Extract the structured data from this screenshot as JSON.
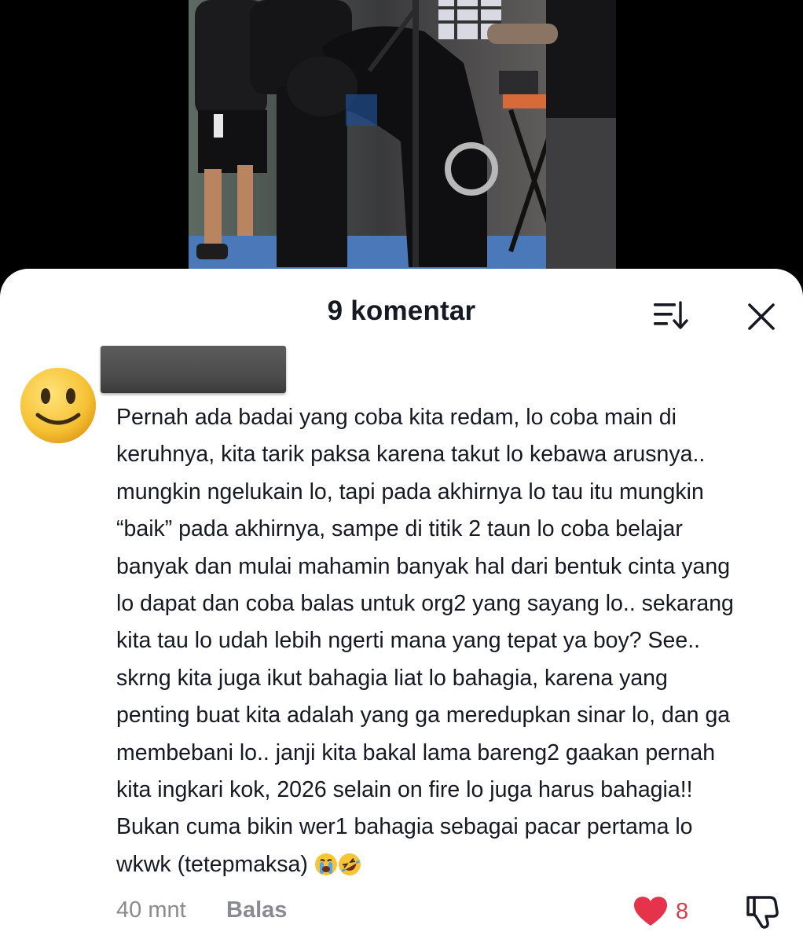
{
  "sheet": {
    "title": "9 komentar"
  },
  "icons": {
    "sort": "sort-icon",
    "close": "close-icon",
    "like": "heart-icon",
    "dislike": "thumbs-down-icon",
    "avatar": "smiley-avatar"
  },
  "comment": {
    "text_lines": [
      "Pernah ada badai yang coba kita redam, lo coba main di",
      "keruhnya, kita tarik paksa karena takut lo kebawa arusnya..",
      "mungkin ngelukain lo, tapi pada akhirnya lo tau itu mungkin",
      "“baik” pada akhirnya, sampe di titik 2 taun lo coba belajar",
      "banyak dan mulai mahamin banyak hal dari bentuk cinta yang",
      "lo dapat dan coba balas untuk org2 yang sayang lo.. sekarang",
      "kita tau lo udah lebih ngerti mana yang tepat ya boy? See..",
      "skrng kita juga ikut bahagia liat lo bahagia, karena yang",
      "penting buat kita adalah yang ga meredupkan sinar lo, dan ga",
      "membebani lo.. janji kita bakal lama bareng2 gaakan pernah",
      "kita ingkari kok, 2026 selain on fire lo juga harus bahagia!!",
      "Bukan cuma bikin wer1 bahagia sebagai pacar pertama lo",
      "wkwk (tetepmaksa)"
    ],
    "emojis": [
      "😭",
      "🤣"
    ],
    "timestamp": "40 mnt",
    "reply_label": "Balas",
    "like_count": "8"
  },
  "colors": {
    "like": "#e5334b",
    "like_count": "#d43f4f",
    "meta": "#8a8b91",
    "text": "#161823"
  }
}
